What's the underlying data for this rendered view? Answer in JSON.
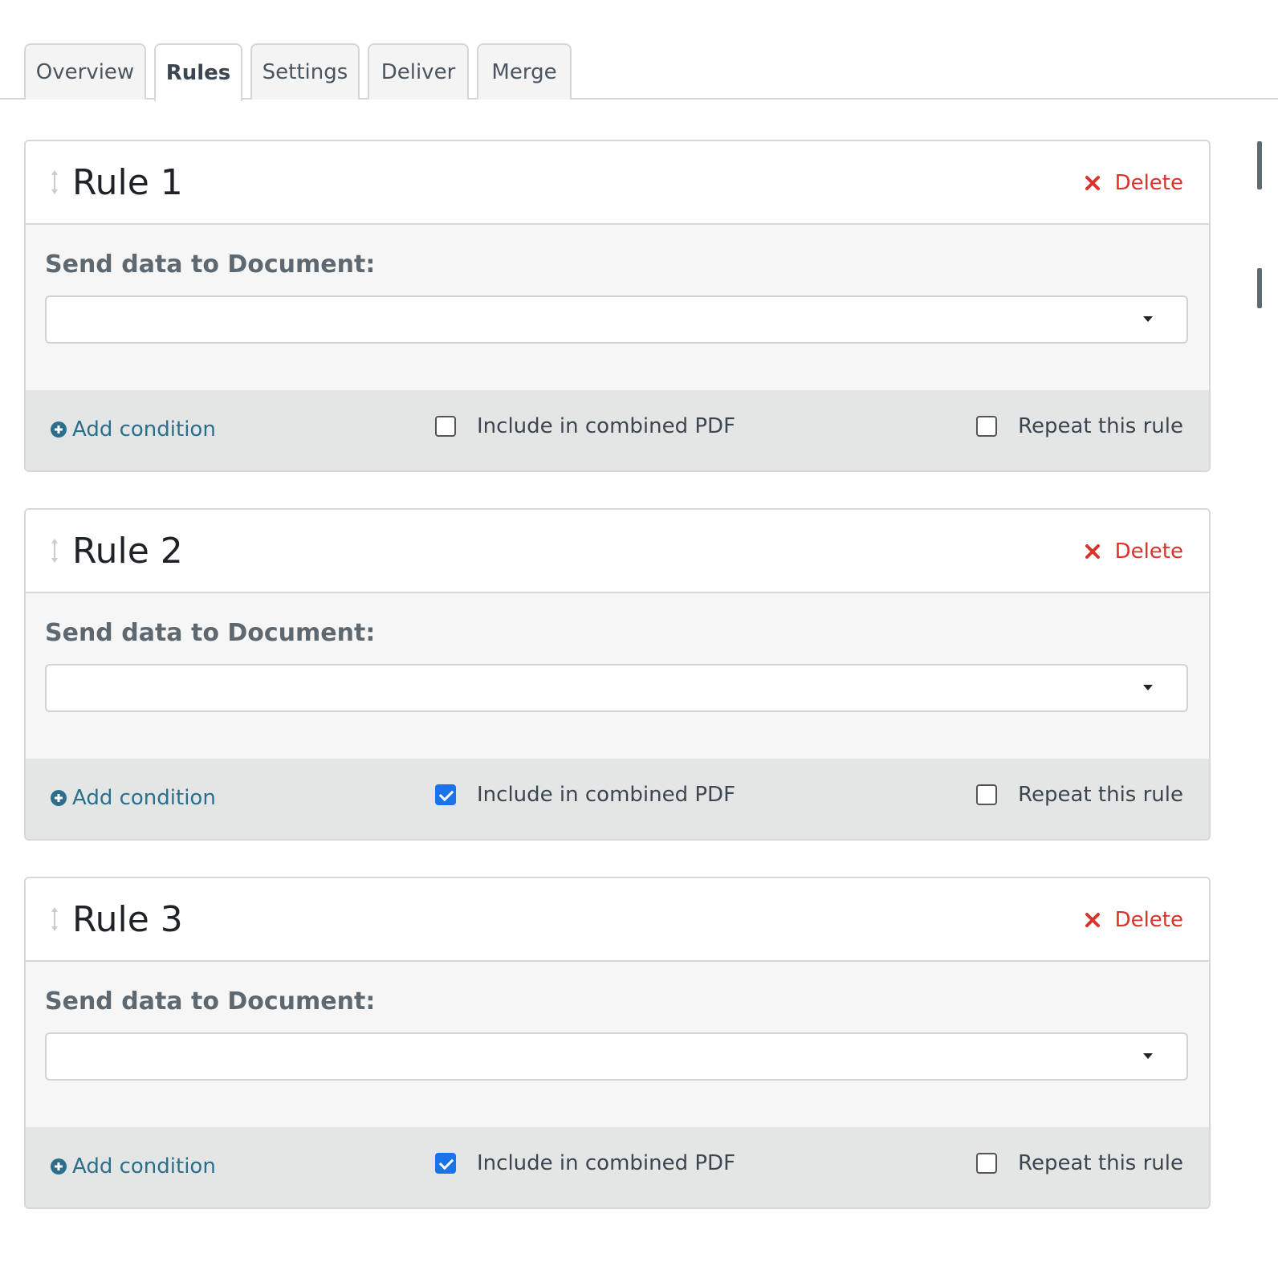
{
  "tabs": [
    {
      "label": "Overview",
      "active": false
    },
    {
      "label": "Rules",
      "active": true
    },
    {
      "label": "Settings",
      "active": false
    },
    {
      "label": "Deliver",
      "active": false
    },
    {
      "label": "Merge",
      "active": false
    }
  ],
  "rules": [
    {
      "title": "Rule 1",
      "delete_label": "Delete",
      "field_label": "Send data to Document:",
      "document_value": "",
      "add_condition_label": "Add condition",
      "include_pdf_label": "Include in combined PDF",
      "include_pdf_checked": false,
      "repeat_label": "Repeat this rule",
      "repeat_checked": false
    },
    {
      "title": "Rule 2",
      "delete_label": "Delete",
      "field_label": "Send data to Document:",
      "document_value": "",
      "add_condition_label": "Add condition",
      "include_pdf_label": "Include in combined PDF",
      "include_pdf_checked": true,
      "repeat_label": "Repeat this rule",
      "repeat_checked": false
    },
    {
      "title": "Rule 3",
      "delete_label": "Delete",
      "field_label": "Send data to Document:",
      "document_value": "",
      "add_condition_label": "Add condition",
      "include_pdf_label": "Include in combined PDF",
      "include_pdf_checked": true,
      "repeat_label": "Repeat this rule",
      "repeat_checked": false
    }
  ],
  "colors": {
    "delete": "#d9342b",
    "link": "#2c6f8c",
    "checkbox_checked": "#1a73e8"
  },
  "icons": {
    "drag": "drag-handle-icon",
    "delete": "close-icon",
    "add": "plus-circle-icon",
    "select": "caret-down-icon"
  }
}
